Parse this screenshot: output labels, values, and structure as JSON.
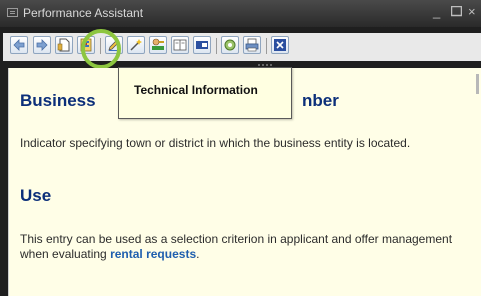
{
  "window": {
    "title": "Performance Assistant",
    "controls": [
      "minimize-icon",
      "maximize-icon",
      "close-icon"
    ]
  },
  "toolbar": {
    "buttons": [
      {
        "icon": "back-arrow-icon"
      },
      {
        "icon": "forward-arrow-icon"
      },
      {
        "icon": "document-icon"
      },
      {
        "icon": "technical-information-icon"
      },
      {
        "icon": "edit-icon"
      },
      {
        "icon": "wizard-icon"
      },
      {
        "icon": "user-key-icon"
      },
      {
        "icon": "book-icon"
      },
      {
        "icon": "split-view-icon"
      },
      {
        "icon": "gear-settings-icon"
      },
      {
        "icon": "print-icon"
      },
      {
        "icon": "close-box-icon"
      }
    ]
  },
  "tooltip": {
    "text": "Technical Information"
  },
  "content": {
    "heading_left": "Business",
    "heading_right": "nber",
    "definition": "Indicator specifying town or district in which the business entity is located.",
    "use_heading": "Use",
    "use_text": "This entry can be used as a selection criterion in applicant and offer management when evaluating ",
    "use_link": "rental requests",
    "use_end": "."
  },
  "colors": {
    "content_background": "#fffee7",
    "heading": "#0c2f7a",
    "link": "#1f5fae",
    "highlight_ring": "#8dc63f"
  }
}
